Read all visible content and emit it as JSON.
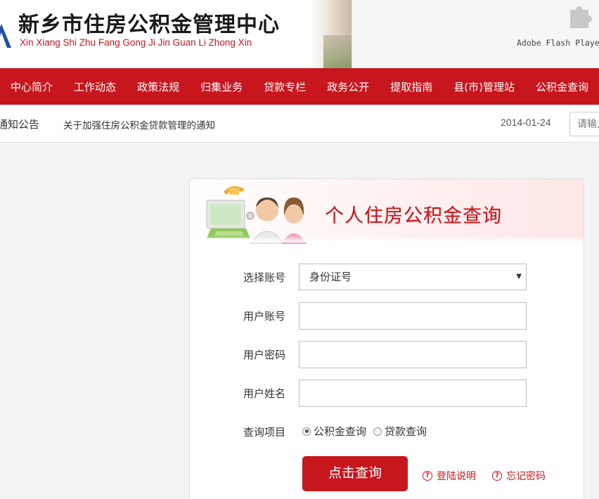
{
  "header": {
    "title_cn": "新乡市住房公积金管理中心",
    "title_en": "Xin Xiang Shi Zhu Fang Gong Ji Jin Guan Li Zhong Xin",
    "flash_text": "Adobe Flash Player"
  },
  "nav": {
    "items": [
      {
        "label": "中心简介"
      },
      {
        "label": "工作动态"
      },
      {
        "label": "政策法规"
      },
      {
        "label": "归集业务"
      },
      {
        "label": "贷款专栏"
      },
      {
        "label": "政务公开"
      },
      {
        "label": "提取指南"
      },
      {
        "label": "县(市)管理站"
      },
      {
        "label": "公积金查询"
      }
    ]
  },
  "notice": {
    "title": "通知公告",
    "text": "关于加强住房公积金贷款管理的通知",
    "date": "2014-01-24",
    "search_placeholder": "请输入"
  },
  "panel": {
    "title": "个人住房公积金查询",
    "labels": {
      "account_type": "选择账号",
      "account": "用户账号",
      "password": "用户密码",
      "name": "用户姓名",
      "query_item": "查询项目"
    },
    "select_value": "身份证号",
    "radio_options": [
      "公积金查询",
      "贷款查询"
    ],
    "radio_selected": 0,
    "submit_label": "点击查询",
    "help_login": "登陆说明",
    "help_forgot": "忘记密码"
  },
  "colors": {
    "brand_red": "#c8161e"
  }
}
